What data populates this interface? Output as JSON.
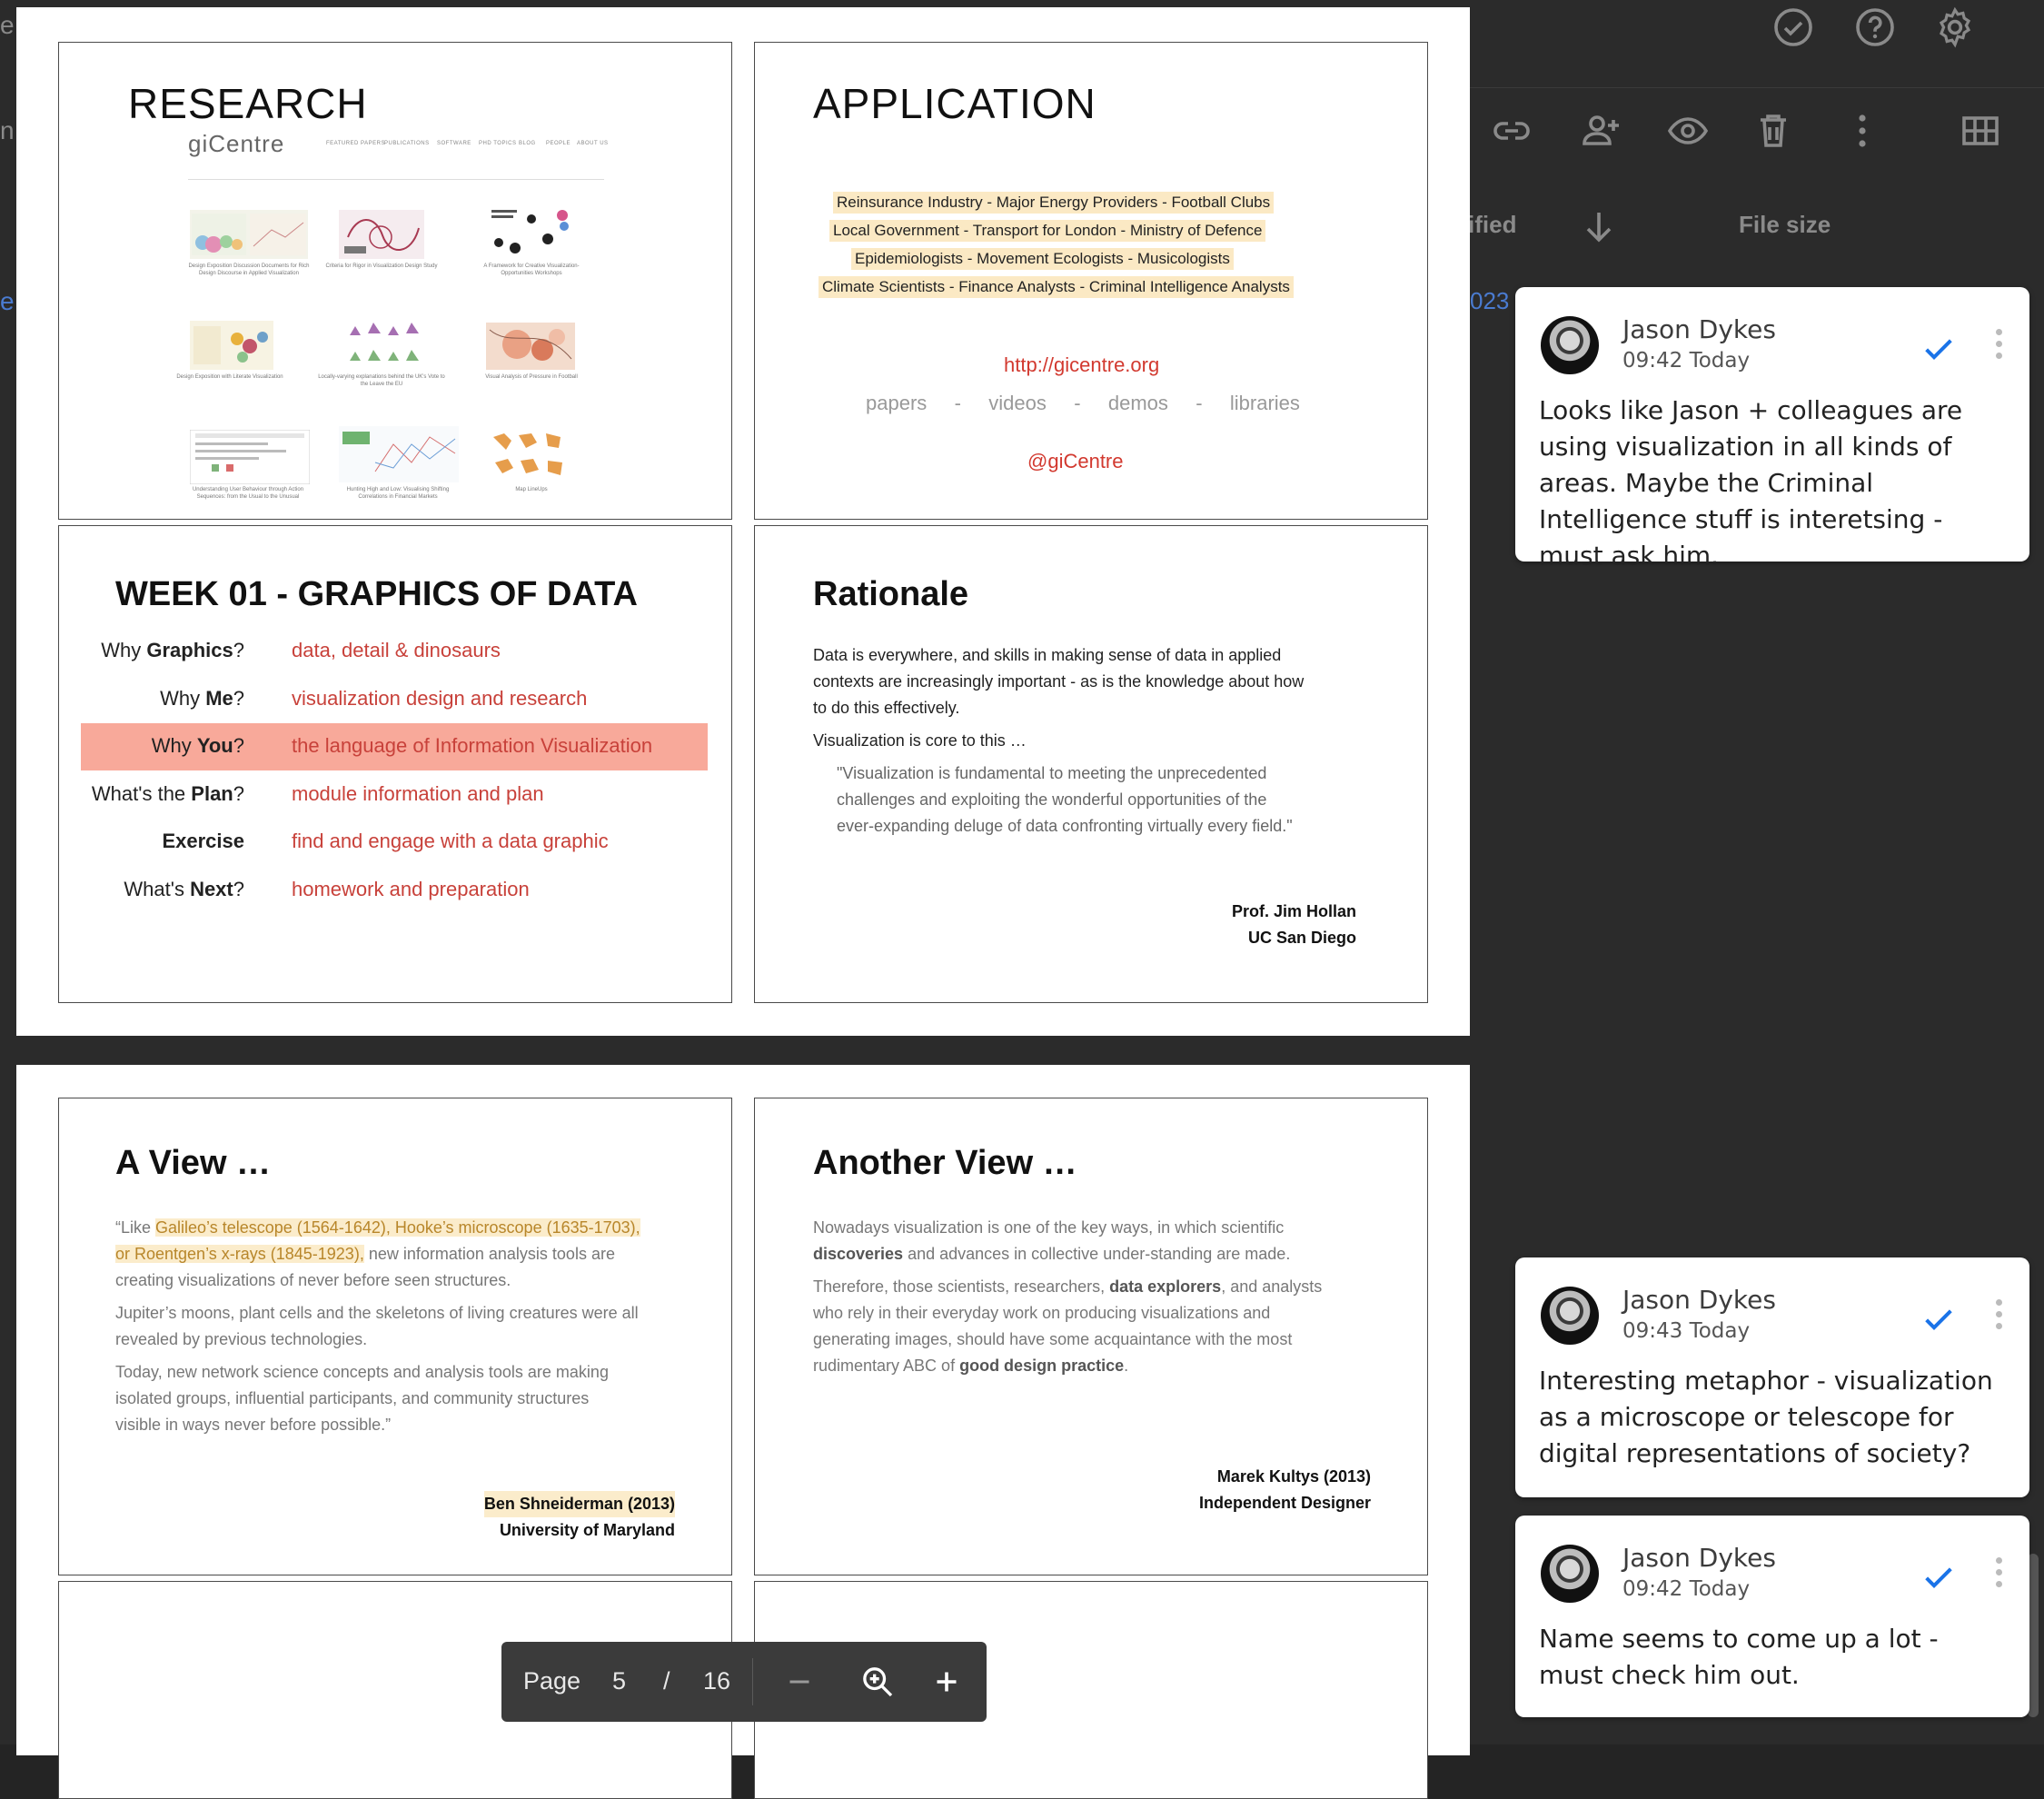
{
  "drive": {
    "column_modified": "ified",
    "column_filesize": "File size",
    "date_fragment": "023",
    "left_fragments": [
      "e",
      "n",
      "e"
    ],
    "top_icons": [
      "check-circle-icon",
      "help-icon",
      "settings-icon"
    ],
    "toolbar_icons": [
      "link-icon",
      "add-person-icon",
      "eye-icon",
      "trash-icon",
      "more-vert-icon",
      "grid-view-icon"
    ]
  },
  "slides": {
    "research": {
      "title": "RESEARCH",
      "logo": "giCentre",
      "nav": [
        "FEATURED PAPERS",
        "PUBLICATIONS",
        "SOFTWARE",
        "PHD TOPICS",
        "BLOG",
        "PEOPLE",
        "ABOUT US"
      ],
      "thumbs": [
        "Design Exposition Discussion Documents for Rich Design Discourse in Applied Visualization",
        "Criteria for Rigor in Visualization Design Study",
        "A Framework for Creative Visualization-Opportunities Workshops",
        "Design Exposition with Literate Visualization",
        "Locally-varying explanations behind the UK's Vote to the Leave the EU",
        "Visual Analysis of Pressure in Football",
        "Understanding User Behaviour through Action Sequences: from the Usual to the Unusual",
        "Hunting High and Low: Visualising Shifting Correlations in Financial Markets",
        "Map LineUps"
      ]
    },
    "application": {
      "title": "APPLICATION",
      "rows": [
        "Reinsurance Industry   -   Major Energy Providers   -   Football Clubs",
        "Local Government   -   Transport for London   -   Ministry of Defence",
        "Epidemiologists   -   Movement Ecologists   -   Musicologists",
        "Climate Scientists   -   Finance Analysts   -   Criminal Intelligence Analysts"
      ],
      "url": "http://gicentre.org",
      "links": "papers   -   videos   -   demos   -   libraries",
      "handle": "@giCentre"
    },
    "week": {
      "title": "WEEK 01 - GRAPHICS OF DATA",
      "rows": [
        {
          "label_pre": "Why ",
          "label_bold": "Graphics",
          "label_post": "?",
          "value": "data, detail & dinosaurs"
        },
        {
          "label_pre": "Why ",
          "label_bold": "Me",
          "label_post": "?",
          "value": "visualization design and research"
        },
        {
          "label_pre": "Why ",
          "label_bold": "You",
          "label_post": "?",
          "value": "the language of Information Visualization"
        },
        {
          "label_pre": "What's the ",
          "label_bold": "Plan",
          "label_post": "?",
          "value": "module information and plan"
        },
        {
          "label_pre": "",
          "label_bold": "Exercise",
          "label_post": "",
          "value": "find and engage with a data graphic"
        },
        {
          "label_pre": "What's ",
          "label_bold": "Next",
          "label_post": "?",
          "value": "homework and preparation"
        }
      ]
    },
    "rationale": {
      "title": "Rationale",
      "para1_line1": "Data is everywhere, and skills in making sense of data in applied",
      "para1_line2": "contexts are increasingly important - as is the knowledge about how",
      "para1_line3": "to do this effectively.",
      "para2": "Visualization is core to this …",
      "quote_line1": "\"Visualization is fundamental to meeting the unprecedented",
      "quote_line2": "challenges and exploiting the wonderful opportunities of the",
      "quote_line3": "ever-expanding deluge of data confronting virtually every field.\"",
      "attrib_name": "Prof. Jim Hollan",
      "attrib_org": "UC San Diego"
    },
    "view": {
      "title": "A View …",
      "l1_pre": "“Like ",
      "l1_hl": "Galileo’s telescope (1564-1642), Hooke’s microscope (1635-1703),",
      "l2_hl": "or Roentgen’s x-rays (1845-1923),",
      "l2_post": " new information analysis tools are",
      "l3": "creating visualizations of never before seen structures.",
      "p2_l1": "Jupiter’s moons, plant cells and the skeletons of living creatures were all",
      "p2_l2": "revealed by previous technologies.",
      "p3_l1": "Today, new network science concepts and analysis tools are making",
      "p3_l2": "isolated groups, influential participants, and community structures",
      "p3_l3": "visible in ways never before possible.”",
      "attrib_name": "Ben Shneiderman (2013)",
      "attrib_org": "University of Maryland"
    },
    "another": {
      "title": "Another View …",
      "p1_l1": "Nowadays visualization is one of the key ways, in which scientific",
      "p1_l2_bold": "discoveries",
      "p1_l2": " and advances in collective under-standing are made.",
      "p2_l1_pre": "Therefore, those scientists, researchers, ",
      "p2_l1_bold": "data explorers",
      "p2_l1_post": ", and analysts",
      "p2_l2": "who rely in their everyday work on producing visualizations and",
      "p2_l3": "generating images, should have some acquaintance with the most",
      "p2_l4_pre": "rudimentary ABC of ",
      "p2_l4_bold": "good design practice",
      "p2_l4_post": ".",
      "attrib_name": "Marek Kultys (2013)",
      "attrib_org": "Independent Designer"
    }
  },
  "comments": [
    {
      "author": "Jason Dykes",
      "time": "09:42 Today",
      "body": "Looks like Jason + colleagues are using visualization in all kinds of areas. Maybe the Criminal Intelligence stuff is interetsing - must ask him."
    },
    {
      "author": "Jason Dykes",
      "time": "09:43 Today",
      "body": "Interesting metaphor - visualization as a microscope or telescope for digital representations of society?"
    },
    {
      "author": "Jason Dykes",
      "time": "09:42 Today",
      "body": "Name seems to come up a lot - must check him out."
    }
  ],
  "page_toolbar": {
    "label": "Page",
    "current": "5",
    "separator": "/",
    "total": "16"
  }
}
